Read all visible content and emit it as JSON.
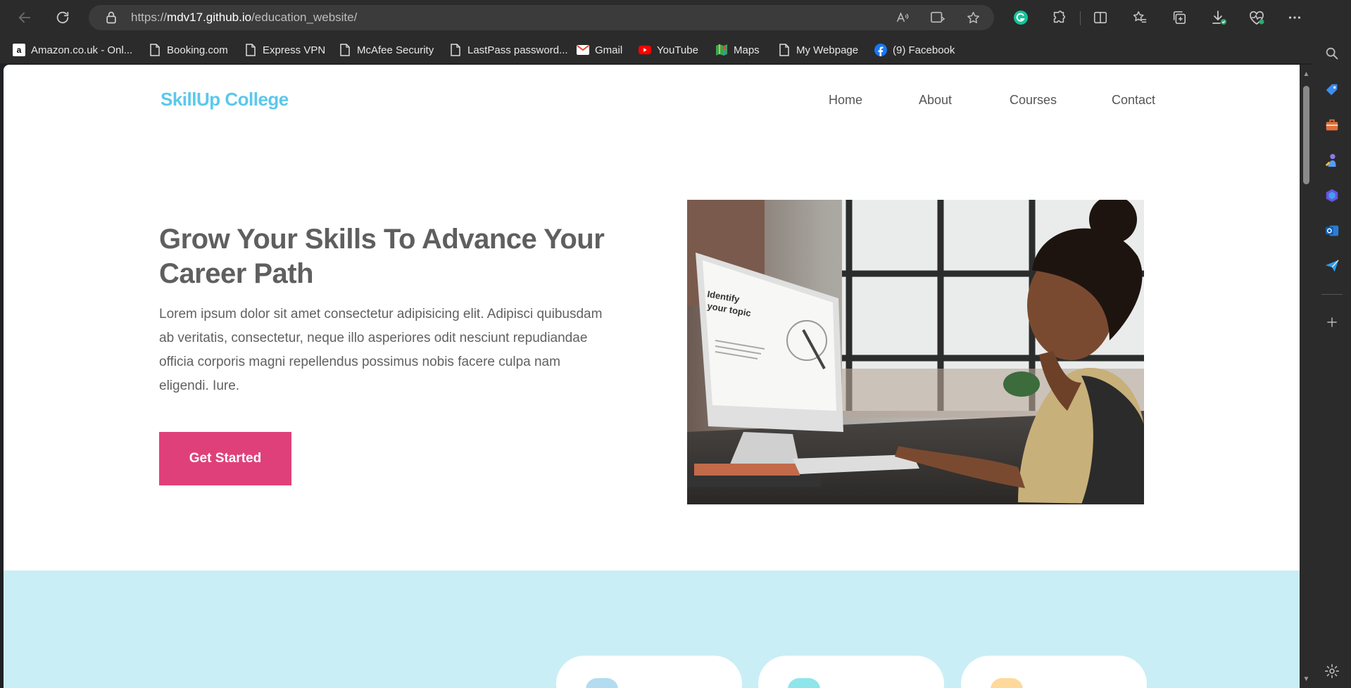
{
  "browser": {
    "url_prefix": "https://",
    "url_host": "mdv17.github.io",
    "url_path": "/education_website/"
  },
  "bookmarks": [
    {
      "label": "Amazon.co.uk - Onl...",
      "icon": "amazon-icon"
    },
    {
      "label": "Booking.com",
      "icon": "page-icon"
    },
    {
      "label": "Express VPN",
      "icon": "page-icon"
    },
    {
      "label": "McAfee Security",
      "icon": "page-icon"
    },
    {
      "label": "LastPass password...",
      "icon": "page-icon"
    },
    {
      "label": "Gmail",
      "icon": "gmail-icon"
    },
    {
      "label": "YouTube",
      "icon": "youtube-icon"
    },
    {
      "label": "Maps",
      "icon": "maps-icon"
    },
    {
      "label": "My Webpage",
      "icon": "page-icon"
    },
    {
      "label": "(9) Facebook",
      "icon": "facebook-icon"
    }
  ],
  "site": {
    "logo": "SkillUp College",
    "nav": [
      "Home",
      "About",
      "Courses",
      "Contact"
    ],
    "hero": {
      "title": "Grow Your Skills To Advance Your Career Path",
      "body": "Lorem ipsum dolor sit amet consectetur adipisicing elit. Adipisci quibusdam ab veritatis, consectetur, neque illo asperiores odit nesciunt repudiandae officia corporis magni repellendus possimus nobis facere culpa nam eligendi. Iure.",
      "cta": "Get Started",
      "screen_text_1": "Identify",
      "screen_text_2": "your topic"
    }
  },
  "colors": {
    "logo": "#5bc8ec",
    "cta": "#e0407a",
    "band": "#c9eef6",
    "card_dots": [
      "#b3dcf0",
      "#8ee6ea",
      "#ffd99a"
    ]
  }
}
